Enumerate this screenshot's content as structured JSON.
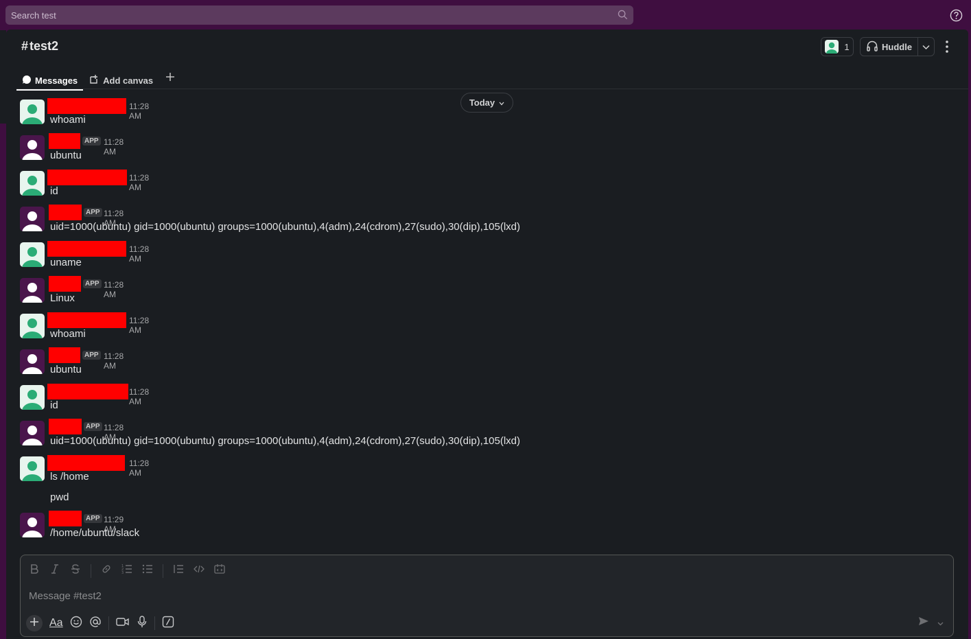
{
  "search": {
    "placeholder": "Search test"
  },
  "channel": {
    "hash": "#",
    "name": "test2"
  },
  "header": {
    "member_count": "1",
    "huddle_label": "Huddle"
  },
  "tabs": [
    {
      "label": "Messages",
      "active": true
    },
    {
      "label": "Add canvas",
      "active": false
    }
  ],
  "date_divider": "Today",
  "messages": [
    {
      "avatar": "user-avatar-green",
      "app": false,
      "time": "11:28 AM",
      "text": "whoami"
    },
    {
      "avatar": "bot-avatar-purple",
      "app": true,
      "time": "11:28 AM",
      "text": "ubuntu"
    },
    {
      "avatar": "user-avatar-green",
      "app": false,
      "time": "11:28 AM",
      "text": "id"
    },
    {
      "avatar": "bot-avatar-purple",
      "app": true,
      "time": "11:28 AM",
      "text": "uid=1000(ubuntu) gid=1000(ubuntu) groups=1000(ubuntu),4(adm),24(cdrom),27(sudo),30(dip),105(lxd)"
    },
    {
      "avatar": "user-avatar-green",
      "app": false,
      "time": "11:28 AM",
      "text": "uname"
    },
    {
      "avatar": "bot-avatar-purple",
      "app": true,
      "time": "11:28 AM",
      "text": "Linux"
    },
    {
      "avatar": "user-avatar-green",
      "app": false,
      "time": "11:28 AM",
      "text": "whoami"
    },
    {
      "avatar": "bot-avatar-purple",
      "app": true,
      "time": "11:28 AM",
      "text": "ubuntu"
    },
    {
      "avatar": "user-avatar-green",
      "app": false,
      "time": "11:28 AM",
      "text": "id"
    },
    {
      "avatar": "bot-avatar-purple",
      "app": true,
      "time": "11:28 AM",
      "text": "uid=1000(ubuntu) gid=1000(ubuntu) groups=1000(ubuntu),4(adm),24(cdrom),27(sudo),30(dip),105(lxd)"
    },
    {
      "avatar": "user-avatar-green",
      "app": false,
      "time": "11:28 AM",
      "text": "ls /home"
    },
    {
      "avatar": "bot-avatar-purple",
      "app": true,
      "time": "11:29 AM",
      "text": "/home/ubuntu/slack"
    }
  ],
  "continuation_message": "pwd",
  "app_badge": "APP",
  "composer": {
    "placeholder": "Message #test2",
    "text_style_label": "Aa"
  },
  "colors": {
    "workspace_bg": "#3f0e40",
    "main_bg": "#1a1d21",
    "redaction": "#ff0000",
    "user_avatar": "#2bac76",
    "bot_avatar": "#4a154b"
  }
}
